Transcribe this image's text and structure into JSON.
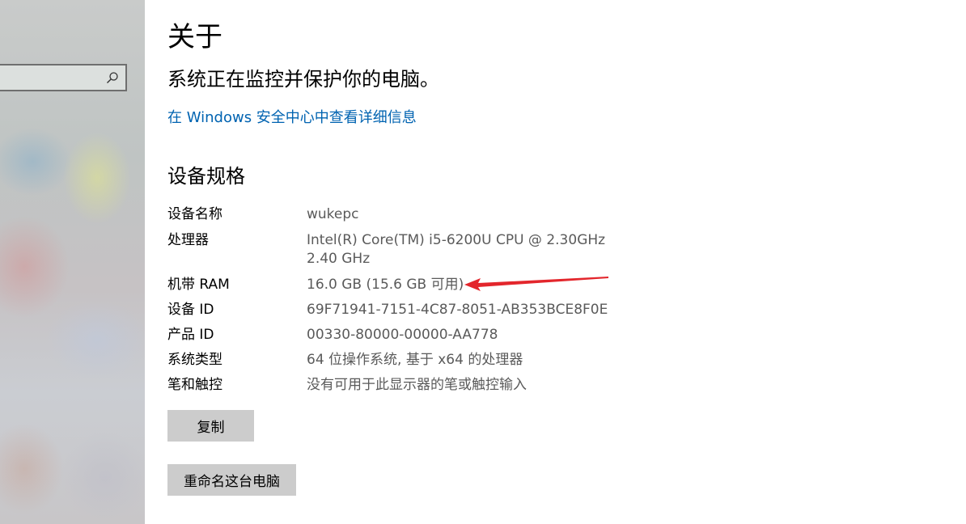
{
  "page": {
    "title": "关于",
    "protect_message": "系统正在监控并保护你的电脑。",
    "security_link": "在 Windows 安全中心中查看详细信息"
  },
  "sidebar": {
    "search": {
      "placeholder": "",
      "icon": "search-icon"
    }
  },
  "specs": {
    "section_title": "设备规格",
    "rows": [
      {
        "label": "设备名称",
        "value": "wukepc"
      },
      {
        "label": "处理器",
        "value": "Intel(R) Core(TM) i5-6200U CPU @ 2.30GHz",
        "value2": "2.40 GHz"
      },
      {
        "label": "机带 RAM",
        "value": "16.0 GB (15.6 GB 可用)"
      },
      {
        "label": "设备 ID",
        "value": "69F71941-7151-4C87-8051-AB353BCE8F0E"
      },
      {
        "label": "产品 ID",
        "value": "00330-80000-00000-AA778"
      },
      {
        "label": "系统类型",
        "value": "64 位操作系统, 基于 x64 的处理器"
      },
      {
        "label": "笔和触控",
        "value": "没有可用于此显示器的笔或触控输入"
      }
    ]
  },
  "buttons": {
    "copy": "复制",
    "rename": "重命名这台电脑"
  },
  "colors": {
    "link": "#0063b1",
    "value_text": "#5a5a5a",
    "button_bg": "#cccccc",
    "annotation_arrow": "#e3262c"
  }
}
